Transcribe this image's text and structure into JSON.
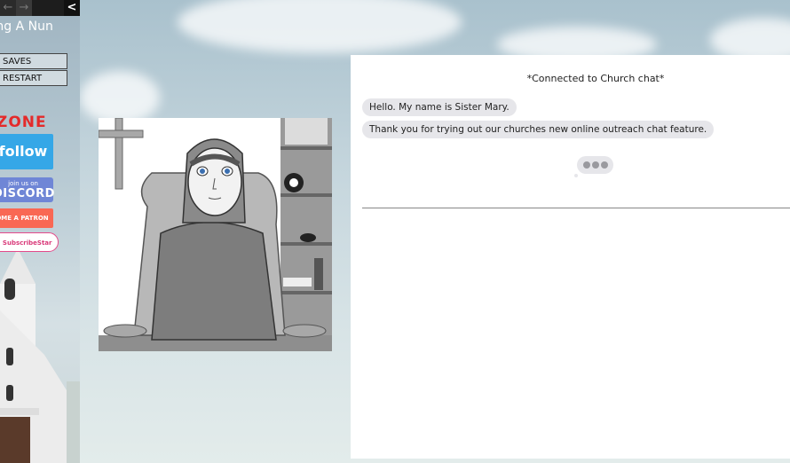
{
  "sidebar": {
    "nav": {
      "back_icon": "back-arrow-icon",
      "forward_icon": "forward-arrow-icon",
      "toggle_icon": "chevron-left-icon",
      "toggle_glyph": "<"
    },
    "story_title": "ting A Nun",
    "menu": {
      "saves_label": "SAVES",
      "restart_label": "RESTART"
    },
    "links": {
      "zone_logo": "ZONE",
      "follow_label": "follow",
      "discord_small": "join us on",
      "discord_big": "DISCORD",
      "patron_label": "OME A PATRON",
      "subscribestar_label": "n SubscribeStar"
    }
  },
  "chat": {
    "status": "*Connected to Church chat*",
    "messages": [
      {
        "text": "Hello. My name is Sister Mary."
      },
      {
        "text": "Thank you for trying out our churches new online outreach chat feature."
      }
    ],
    "typing_indicator": true
  },
  "colors": {
    "twitch": "#35a7e7",
    "discord": "#6f86d6",
    "patreon": "#f96854",
    "subscribestar": "#d93a7a",
    "bubble": "#e6e6ea"
  }
}
